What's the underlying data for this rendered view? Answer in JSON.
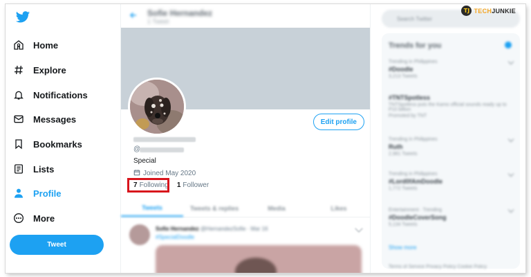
{
  "nav": {
    "items": [
      {
        "label": "Home",
        "icon": "home-icon"
      },
      {
        "label": "Explore",
        "icon": "hashtag-icon"
      },
      {
        "label": "Notifications",
        "icon": "bell-icon"
      },
      {
        "label": "Messages",
        "icon": "envelope-icon"
      },
      {
        "label": "Bookmarks",
        "icon": "bookmark-icon"
      },
      {
        "label": "Lists",
        "icon": "list-icon"
      },
      {
        "label": "Profile",
        "icon": "person-icon"
      },
      {
        "label": "More",
        "icon": "more-circle-icon"
      }
    ],
    "active_item": "Profile",
    "tweet_button": "Tweet"
  },
  "header": {
    "name": "Sofie Hernandez",
    "tweet_count": "1 Tweet"
  },
  "profile": {
    "edit_button": "Edit profile",
    "handle_prefix": "@",
    "bio": "Special",
    "joined": "Joined May 2020",
    "following_count": "7",
    "following_label": "Following",
    "followers_count": "1",
    "followers_label": "Follower"
  },
  "tabs": [
    "Tweets",
    "Tweets & replies",
    "Media",
    "Likes"
  ],
  "tweet": {
    "author": "Sofie Hernandez",
    "meta": "@HernandezSofie · Mar 16",
    "link": "#SpecialDoodle"
  },
  "sidebar": {
    "search_placeholder": "Search Twitter",
    "trends_title": "Trends for you",
    "trends": [
      {
        "context": "Trending in Philippines",
        "name": "#Doodle",
        "count": "3,213 Tweets"
      },
      {
        "context": "",
        "name": "#TNTSpotless",
        "count": "TNTSpotless puts the Kamo official sounds ready up to P10 billion",
        "promoted": "Promoted by TNT"
      },
      {
        "context": "Trending in Philippines",
        "name": "Ruth",
        "count": "2,981 Tweets"
      },
      {
        "context": "Trending in Philippines",
        "name": "#Lord0fAmDoodle",
        "count": "1,772 Tweets"
      },
      {
        "context": "Entertainment · Trending",
        "name": "#DoodleCoverSong",
        "count": "5,134 Tweets"
      }
    ],
    "show_more": "Show more",
    "footer": "Terms of Service  Privacy Policy  Cookie Policy"
  },
  "watermark": {
    "badge": "TJ",
    "text_prefix": "TECH",
    "text_suffix": "JUNKIE"
  },
  "colors": {
    "accent": "#1da1f2",
    "highlight_box": "#d8141c",
    "banner": "#c8d1d8"
  }
}
